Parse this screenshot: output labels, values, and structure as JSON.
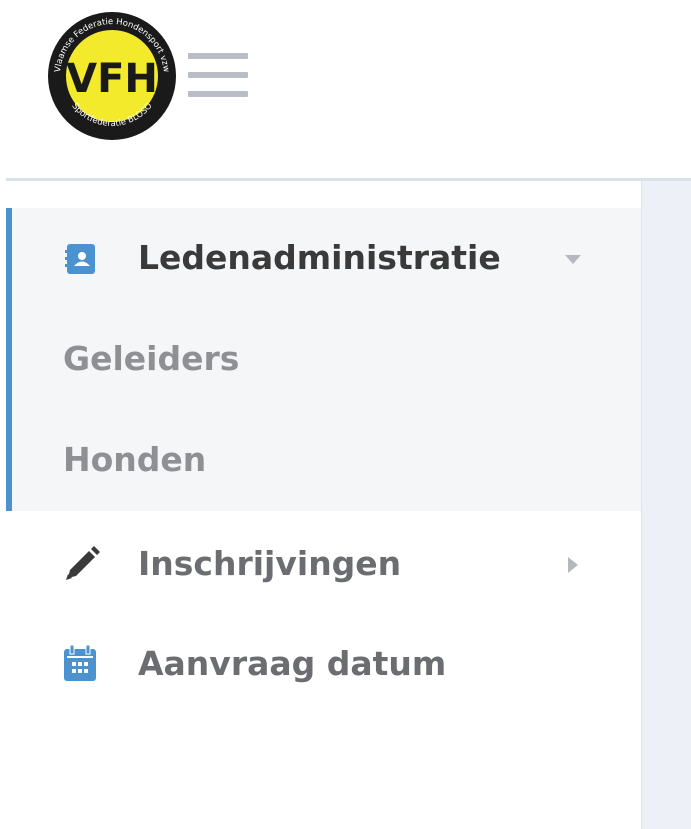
{
  "header": {
    "logo": {
      "ring_text_top": "Vlaamse Federatie Hondensport vzw",
      "ring_text_bottom": "Sportfederatie BLOSO",
      "center_text": "VFH",
      "ring_color": "#1a1a1a",
      "fill_color": "#f2ea2a"
    },
    "menu_icon": "hamburger-icon"
  },
  "sidebar": {
    "accent_color": "#4a93d0",
    "items": [
      {
        "label": "Ledenadministratie",
        "icon": "contacts-book-icon",
        "expanded": true,
        "children": [
          {
            "label": "Geleiders"
          },
          {
            "label": "Honden"
          }
        ]
      },
      {
        "label": "Inschrijvingen",
        "icon": "pencil-icon",
        "expanded": false
      },
      {
        "label": "Aanvraag datum",
        "icon": "calendar-icon"
      }
    ]
  }
}
